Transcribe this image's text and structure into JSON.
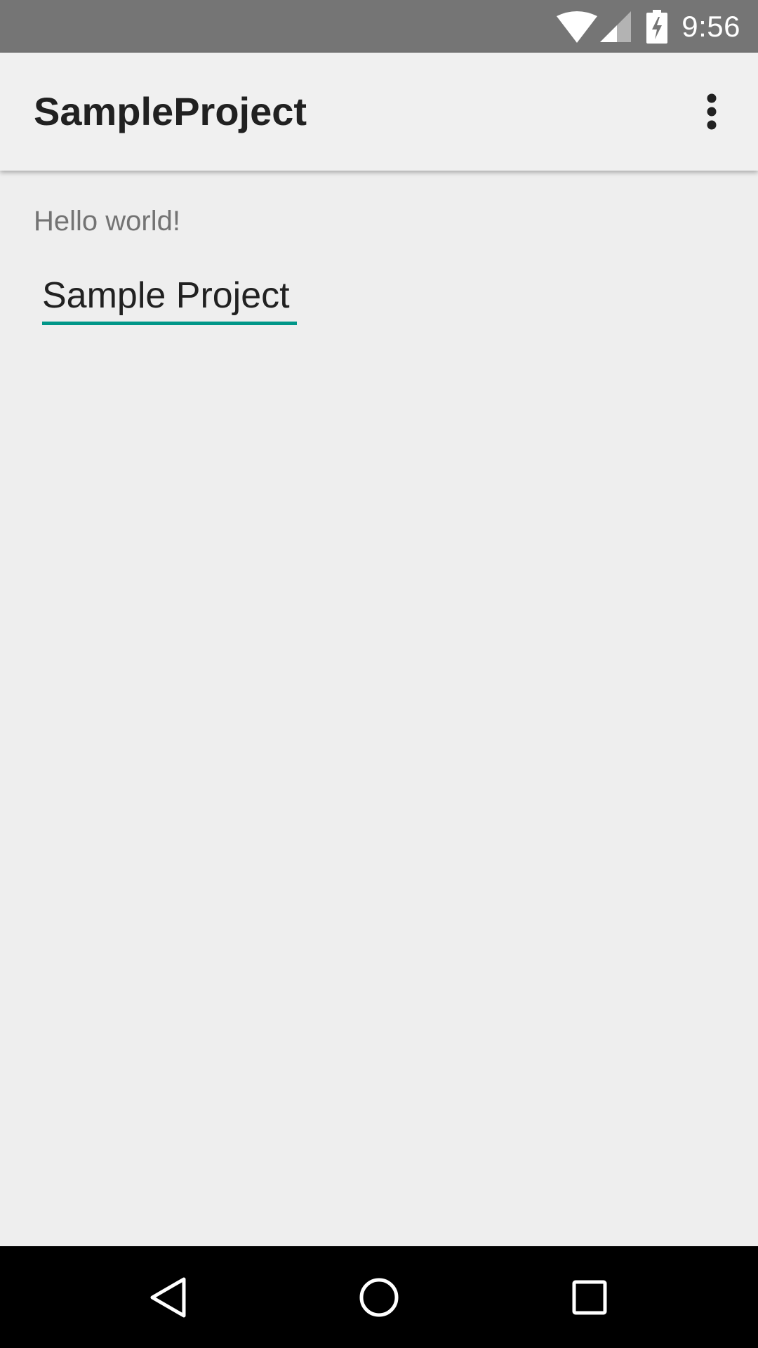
{
  "status_bar": {
    "time": "9:56",
    "icons": [
      "wifi-icon",
      "cell-signal-icon",
      "battery-charging-icon"
    ]
  },
  "app_bar": {
    "title": "SampleProject",
    "overflow_icon": "more-vert-icon"
  },
  "content": {
    "hello_text": "Hello world!",
    "edit_text_value": "Sample Project",
    "accent_color": "#009688"
  },
  "nav_bar": {
    "icons": [
      "back-icon",
      "home-icon",
      "recents-icon"
    ]
  },
  "colors": {
    "status_bar": "#757575",
    "app_bar": "#f0f0f0",
    "background": "#eeeeee",
    "nav_bar": "#000000"
  }
}
